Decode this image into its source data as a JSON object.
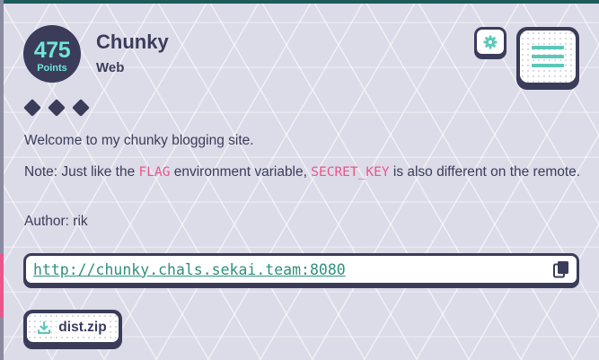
{
  "challenge": {
    "points_value": "475",
    "points_label": "Points",
    "title": "Chunky",
    "category": "Web",
    "difficulty_level": 3
  },
  "description": {
    "line1": "Welcome to my chunky blogging site.",
    "note_prefix": "Note: Just like the ",
    "note_code1": "FLAG",
    "note_mid": " environment variable, ",
    "note_code2": "SECRET_KEY",
    "note_suffix": " is also different on the remote.",
    "author": "Author: rik"
  },
  "connection": {
    "url": "http://chunky.chals.sekai.team:8080"
  },
  "attachment": {
    "label": "dist.zip"
  },
  "icons": {
    "settings": "gear-icon",
    "menu": "hamburger-menu-icon",
    "copy": "copy-icon",
    "download": "download-icon"
  },
  "colors": {
    "dark": "#3a3c5a",
    "accent": "#6ee7d6",
    "code": "#e8568a",
    "link": "#2f8f7f",
    "menu_bar": "#5bc8b8"
  }
}
